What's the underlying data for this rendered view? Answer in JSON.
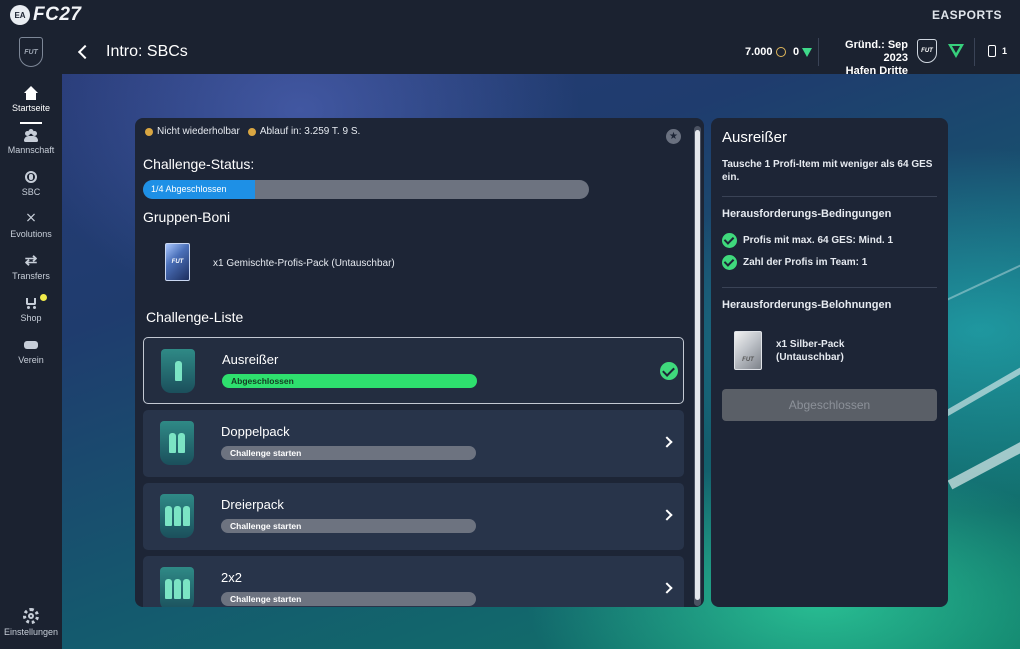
{
  "topbar": {
    "ea_logo": "EA",
    "game_title": "FC27",
    "publisher": "EASPORTS"
  },
  "header": {
    "title": "Intro: SBCs",
    "coins": "7.000",
    "points": "0",
    "club_founded": "Gründ.: Sep 2023",
    "club_name": "Hafen Dritte",
    "badge_text": "FUT",
    "notification_count": "1"
  },
  "sidebar": {
    "crest_text": "FUT",
    "items": [
      {
        "label": "Startseite",
        "icon": "home-icon"
      },
      {
        "label": "Mannschaft",
        "icon": "team-icon"
      },
      {
        "label": "SBC",
        "icon": "sbc-icon"
      },
      {
        "label": "Evolutions",
        "icon": "evolutions-icon"
      },
      {
        "label": "Transfers",
        "icon": "transfers-icon"
      },
      {
        "label": "Shop",
        "icon": "shop-icon"
      },
      {
        "label": "Verein",
        "icon": "club-icon"
      }
    ],
    "settings_label": "Einstellungen"
  },
  "main": {
    "not_repeatable": "Nicht wiederholbar",
    "expiry": "Ablauf in: 3.259 T. 9 S.",
    "status_title": "Challenge-Status:",
    "progress_label": "1/4 Abgeschlossen",
    "progress_fraction": 0.25,
    "group_bonus_title": "Gruppen-Boni",
    "group_pack_badge": "FUT",
    "group_reward": "x1 Gemischte-Profis-Pack (Untauschbar)",
    "list_title": "Challenge-Liste",
    "challenges": [
      {
        "name": "Ausreißer",
        "status": "Abgeschlossen",
        "completed": true
      },
      {
        "name": "Doppelpack",
        "status": "Challenge starten",
        "completed": false
      },
      {
        "name": "Dreierpack",
        "status": "Challenge starten",
        "completed": false
      },
      {
        "name": "2x2",
        "status": "Challenge starten",
        "completed": false
      }
    ]
  },
  "detail": {
    "title": "Ausreißer",
    "description": "Tausche 1 Profi-Item mit weniger als 64 GES ein.",
    "conditions_title": "Herausforderungs-Bedingungen",
    "conditions": [
      "Profis mit max. 64 GES: Mind. 1",
      "Zahl der Profis im Team: 1"
    ],
    "rewards_title": "Herausforderungs-Belohnungen",
    "reward_pack_badge": "FUT",
    "reward": "x1 Silber-Pack (Untauschbar)",
    "button_label": "Abgeschlossen"
  },
  "colors": {
    "panel": "#1d2536",
    "progress_blue": "#1e90e6",
    "success_green": "#3fd97c",
    "bar_grey": "#6d7380"
  }
}
